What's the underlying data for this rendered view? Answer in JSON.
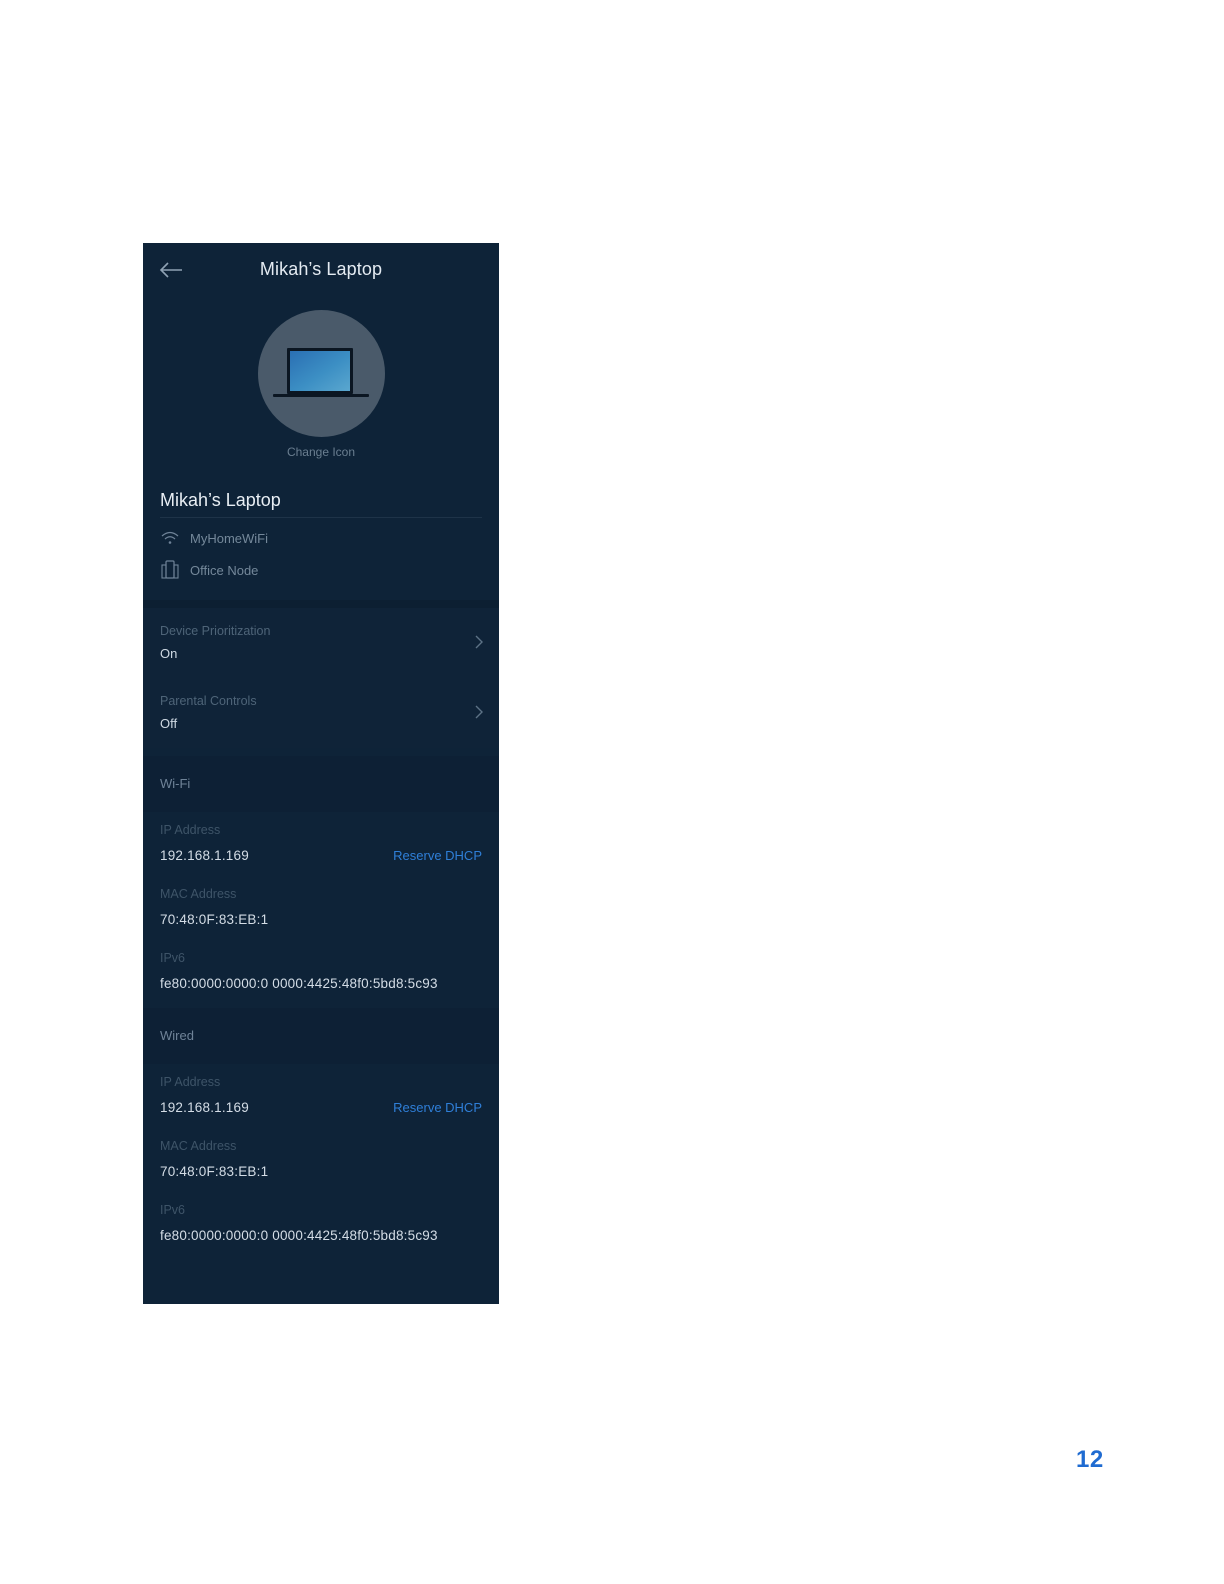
{
  "header": {
    "title": "Mikah’s Laptop"
  },
  "avatar": {
    "icon": "laptop-icon",
    "change_label": "Change Icon"
  },
  "device": {
    "name": "Mikah’s Laptop",
    "network": "MyHomeWiFi",
    "node": "Office Node"
  },
  "settings": [
    {
      "label": "Device Prioritization",
      "value": "On"
    },
    {
      "label": "Parental Controls",
      "value": "Off"
    }
  ],
  "wifi": {
    "section_label": "Wi-Fi",
    "ip_label": "IP Address",
    "ip_value": "192.168.1.169",
    "reserve_label": "Reserve DHCP",
    "mac_label": "MAC Address",
    "mac_value": "70:48:0F:83:EB:1",
    "ipv6_label": "IPv6",
    "ipv6_value": "fe80:0000:0000:0 0000:4425:48f0:5bd8:5c93"
  },
  "wired": {
    "section_label": "Wired",
    "ip_label": "IP Address",
    "ip_value": "192.168.1.169",
    "reserve_label": "Reserve DHCP",
    "mac_label": "MAC Address",
    "mac_value": "70:48:0F:83:EB:1",
    "ipv6_label": "IPv6",
    "ipv6_value": "fe80:0000:0000:0 0000:4425:48f0:5bd8:5c93"
  },
  "page": {
    "number": "12"
  },
  "colors": {
    "background": "#0e2338",
    "accent": "#2f7fd8",
    "page_number": "#1f6bd1"
  }
}
